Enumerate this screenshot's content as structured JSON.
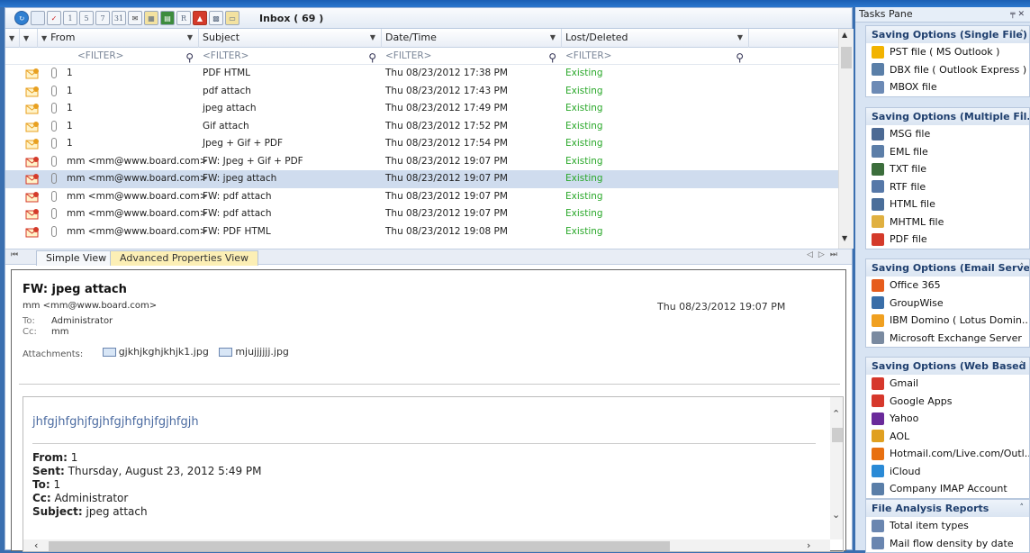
{
  "toolbar": {
    "inbox_title": "Inbox ( 69 )",
    "day_view": "1",
    "five_day_view": "5",
    "week_view": "7",
    "month_view": "31"
  },
  "grid": {
    "headers": {
      "from": "From",
      "subject": "Subject",
      "date": "Date/Time",
      "status": "Lost/Deleted"
    },
    "filter_placeholder": "<FILTER>",
    "rows": [
      {
        "from": "1",
        "subject": "PDF HTML",
        "date": "Thu 08/23/2012 17:38 PM",
        "status": "Existing",
        "kind": "open"
      },
      {
        "from": "1",
        "subject": "pdf attach",
        "date": "Thu 08/23/2012 17:43 PM",
        "status": "Existing",
        "kind": "open"
      },
      {
        "from": "1",
        "subject": "jpeg attach",
        "date": "Thu 08/23/2012 17:49 PM",
        "status": "Existing",
        "kind": "open"
      },
      {
        "from": "1",
        "subject": "Gif attach",
        "date": "Thu 08/23/2012 17:52 PM",
        "status": "Existing",
        "kind": "open"
      },
      {
        "from": "1",
        "subject": "Jpeg + Gif + PDF",
        "date": "Thu 08/23/2012 17:54 PM",
        "status": "Existing",
        "kind": "open"
      },
      {
        "from": "mm <mm@www.board.com>",
        "subject": "FW: Jpeg + Gif + PDF",
        "date": "Thu 08/23/2012 19:07 PM",
        "status": "Existing",
        "kind": "fwd"
      },
      {
        "from": "mm <mm@www.board.com>",
        "subject": "FW: jpeg attach",
        "date": "Thu 08/23/2012 19:07 PM",
        "status": "Existing",
        "kind": "fwd",
        "selected": true
      },
      {
        "from": "mm <mm@www.board.com>",
        "subject": "FW: pdf attach",
        "date": "Thu 08/23/2012 19:07 PM",
        "status": "Existing",
        "kind": "fwd"
      },
      {
        "from": "mm <mm@www.board.com>",
        "subject": "FW: pdf attach",
        "date": "Thu 08/23/2012 19:07 PM",
        "status": "Existing",
        "kind": "fwd"
      },
      {
        "from": "mm <mm@www.board.com>",
        "subject": "FW: PDF HTML",
        "date": "Thu 08/23/2012 19:08 PM",
        "status": "Existing",
        "kind": "fwd"
      }
    ]
  },
  "tabs": {
    "simple": "Simple View",
    "advanced": "Advanced Properties View"
  },
  "preview": {
    "subject": "FW: jpeg attach",
    "from": "mm <mm@www.board.com>",
    "date": "Thu 08/23/2012 19:07 PM",
    "to_label": "To:",
    "to": "Administrator",
    "cc_label": "Cc:",
    "cc": "mm",
    "attachments_label": "Attachments:",
    "attachments": [
      "gjkhjkghjkhjk1.jpg",
      "mjujjjjjj.jpg"
    ],
    "body": {
      "heading": "jhfgjhfghjfgjhfgjhfghjfgjhfgjh",
      "from_label": "From:",
      "from": " 1",
      "sent_label": "Sent:",
      "sent": " Thursday, August 23, 2012 5:49 PM",
      "to_label": "To:",
      "to": " 1",
      "cc_label": "Cc:",
      "cc": " Administrator",
      "subject_label": "Subject:",
      "subject": " jpeg attach"
    }
  },
  "tasks": {
    "title": "Tasks Pane",
    "groups": [
      {
        "title": "Saving Options (Single File)",
        "items": [
          {
            "label": "PST file ( MS Outlook )",
            "icon": "pst-icon",
            "color": "#f2b300"
          },
          {
            "label": "DBX file ( Outlook Express )",
            "icon": "dbx-icon",
            "color": "#5a7fa8"
          },
          {
            "label": "MBOX file",
            "icon": "mbox-icon",
            "color": "#6c8ab5"
          }
        ]
      },
      {
        "title": "Saving Options (Multiple Fil...",
        "items": [
          {
            "label": "MSG file",
            "icon": "envelope-icon",
            "color": "#4c6a94"
          },
          {
            "label": "EML file",
            "icon": "eml-icon",
            "color": "#5c7ea8"
          },
          {
            "label": "TXT file",
            "icon": "txt-icon",
            "color": "#3c6e3c"
          },
          {
            "label": "RTF file",
            "icon": "rtf-icon",
            "color": "#5678a8"
          },
          {
            "label": "HTML file",
            "icon": "html-icon",
            "color": "#4a6e9a"
          },
          {
            "label": "MHTML file",
            "icon": "mhtml-icon",
            "color": "#e0b040"
          },
          {
            "label": "PDF file",
            "icon": "pdf-icon",
            "color": "#d43a2a"
          }
        ]
      },
      {
        "title": "Saving Options (Email Servers)",
        "items": [
          {
            "label": "Office 365",
            "icon": "office365-icon",
            "color": "#e65c1c"
          },
          {
            "label": "GroupWise",
            "icon": "groupwise-icon",
            "color": "#3a6ea8"
          },
          {
            "label": "IBM Domino ( Lotus Domin...",
            "icon": "domino-icon",
            "color": "#f0a020"
          },
          {
            "label": "Microsoft Exchange Server",
            "icon": "exchange-icon",
            "color": "#7a8aa0"
          }
        ]
      },
      {
        "title": "Saving Options (Web Based ...",
        "items": [
          {
            "label": "Gmail",
            "icon": "gmail-icon",
            "color": "#d6382c"
          },
          {
            "label": "Google Apps",
            "icon": "google-apps-icon",
            "color": "#d6382c"
          },
          {
            "label": "Yahoo",
            "icon": "yahoo-icon",
            "color": "#6a2a9a"
          },
          {
            "label": "AOL",
            "icon": "aol-icon",
            "color": "#e0a020"
          },
          {
            "label": "Hotmail.com/Live.com/Outl...",
            "icon": "hotmail-icon",
            "color": "#e87010"
          },
          {
            "label": "iCloud",
            "icon": "icloud-icon",
            "color": "#2a8ad6"
          },
          {
            "label": "Company IMAP Account",
            "icon": "imap-icon",
            "color": "#5a7ea8"
          }
        ]
      },
      {
        "title": "File Analysis Reports",
        "items": [
          {
            "label": "Total item types",
            "icon": "report-icon",
            "color": "#6a86b0"
          },
          {
            "label": "Mail flow density by date",
            "icon": "chart-icon",
            "color": "#6a86b0"
          }
        ]
      }
    ]
  }
}
